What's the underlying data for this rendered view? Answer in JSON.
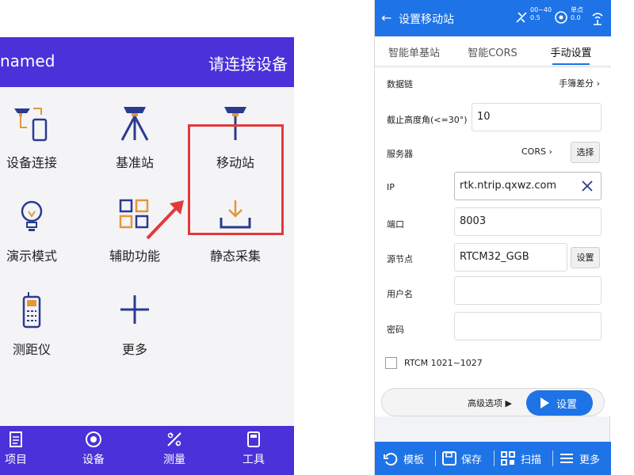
{
  "left_app": {
    "project_name": "named",
    "connect_status": "请连接设备",
    "grid": [
      {
        "label": "设备连接",
        "icon": "device-connect-icon"
      },
      {
        "label": "基准站",
        "icon": "base-station-icon"
      },
      {
        "label": "移动站",
        "icon": "rover-icon"
      },
      {
        "label": "演示模式",
        "icon": "lightbulb-icon"
      },
      {
        "label": "辅助功能",
        "icon": "grid-apps-icon"
      },
      {
        "label": "静态采集",
        "icon": "download-tray-icon"
      },
      {
        "label": "测距仪",
        "icon": "rangefinder-icon"
      },
      {
        "label": "更多",
        "icon": "plus-icon"
      }
    ],
    "nav": [
      {
        "label": "项目",
        "icon": "document-icon"
      },
      {
        "label": "设备",
        "icon": "satellite-dish-icon"
      },
      {
        "label": "测量",
        "icon": "measure-icon"
      },
      {
        "label": "工具",
        "icon": "calculator-icon"
      }
    ],
    "accent_color": "#4a31d9",
    "highlight_color": "#e23a3a"
  },
  "right_app": {
    "title": "设置移动站",
    "status": {
      "sat_top": "00~40",
      "sat_bottom": "0.5",
      "point_top": "单点",
      "point_bottom": "0.0"
    },
    "tabs": [
      "智能单基站",
      "智能CORS",
      "手动设置"
    ],
    "active_tab": 2,
    "form": {
      "datalink_label": "数据链",
      "datalink_value": "手簿差分",
      "cutoff_label": "截止高度角(<=30°)",
      "cutoff_value": "10",
      "server_label": "服务器",
      "server_value": "CORS",
      "server_select_btn": "选择",
      "ip_label": "IP",
      "ip_value": "rtk.ntrip.qxwz.com",
      "port_label": "端口",
      "port_value": "8003",
      "mountpoint_label": "源节点",
      "mountpoint_value": "RTCM32_GGB",
      "mountpoint_btn": "设置",
      "username_label": "用户名",
      "username_value": "",
      "password_label": "密码",
      "password_value": "",
      "rtcm_label": "RTCM 1021~1027",
      "rtcm_checked": false
    },
    "advanced_label": "高级选项 ▶",
    "apply_label": "设置",
    "bottom": [
      {
        "label": "模板",
        "icon": "template-icon"
      },
      {
        "label": "保存",
        "icon": "save-icon"
      },
      {
        "label": "扫描",
        "icon": "qr-scan-icon"
      },
      {
        "label": "更多",
        "icon": "menu-icon"
      }
    ],
    "accent_color": "#1e73e6"
  }
}
